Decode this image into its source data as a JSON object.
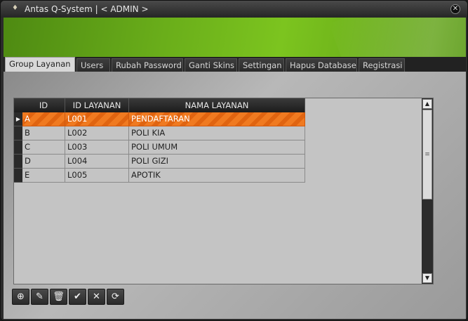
{
  "window": {
    "title": "Antas Q-System | < ADMIN >"
  },
  "tabs": [
    {
      "label": "Group Layanan",
      "active": true
    },
    {
      "label": "Users"
    },
    {
      "label": "Rubah Password"
    },
    {
      "label": "Ganti Skins"
    },
    {
      "label": "Settingan"
    },
    {
      "label": "Hapus Database"
    },
    {
      "label": "Registrasi"
    }
  ],
  "grid": {
    "columns": [
      "ID",
      "ID LAYANAN",
      "NAMA LAYANAN"
    ],
    "rows": [
      {
        "id": "A",
        "id_layanan": "L001",
        "nama_layanan": "PENDAFTARAN",
        "selected": true
      },
      {
        "id": "B",
        "id_layanan": "L002",
        "nama_layanan": "POLI KIA"
      },
      {
        "id": "C",
        "id_layanan": "L003",
        "nama_layanan": "POLI UMUM"
      },
      {
        "id": "D",
        "id_layanan": "L004",
        "nama_layanan": "POLI GIZI"
      },
      {
        "id": "E",
        "id_layanan": "L005",
        "nama_layanan": "APOTIK"
      }
    ]
  },
  "toolbar": {
    "buttons": [
      {
        "icon": "add-icon",
        "glyph": "⊕"
      },
      {
        "icon": "edit-icon",
        "glyph": "✎"
      },
      {
        "icon": "delete-icon",
        "glyph": "🗑"
      },
      {
        "icon": "check-icon",
        "glyph": "✔"
      },
      {
        "icon": "cancel-icon",
        "glyph": "✕"
      },
      {
        "icon": "refresh-icon",
        "glyph": "⟳"
      }
    ]
  },
  "colors": {
    "accent": "#f07a20",
    "banner": "#6aae1a"
  }
}
